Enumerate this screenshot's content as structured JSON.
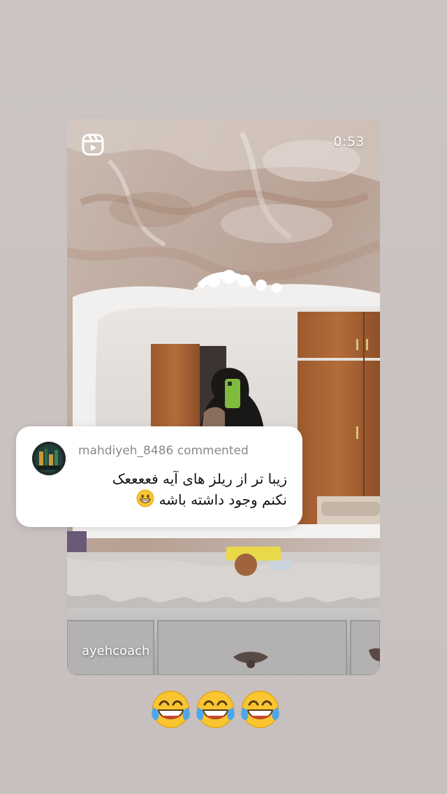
{
  "story": {
    "background_color": "#c9c2c0"
  },
  "reel": {
    "duration": "0:53",
    "author": "ayehcoach",
    "icon": "reels-icon"
  },
  "comment_sticker": {
    "avatar_icon": "user-avatar",
    "header": "mahdiyeh_8486 commented",
    "text_line1": "زیبا تر از ریلز های آیه فععععک",
    "text_line2": "نکنم وجود داشته باشه",
    "inline_emoji": "grinning-face-icon"
  },
  "reaction": {
    "emojis": [
      "tears-of-joy-icon",
      "tears-of-joy-icon",
      "tears-of-joy-icon"
    ]
  }
}
